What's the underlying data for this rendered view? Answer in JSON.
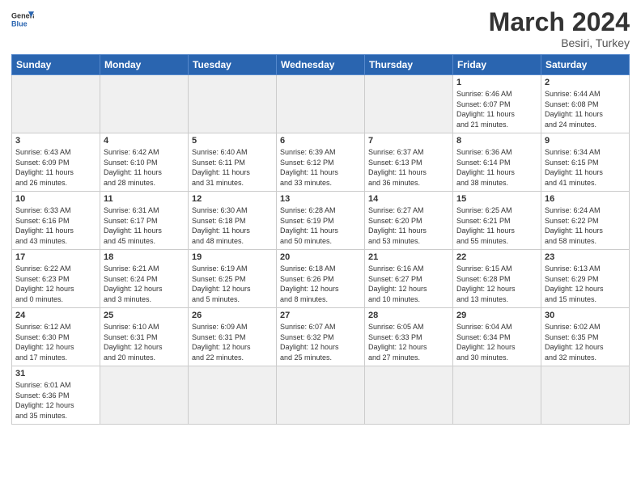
{
  "header": {
    "logo_general": "General",
    "logo_blue": "Blue",
    "month_title": "March 2024",
    "location": "Besiri, Turkey"
  },
  "weekdays": [
    "Sunday",
    "Monday",
    "Tuesday",
    "Wednesday",
    "Thursday",
    "Friday",
    "Saturday"
  ],
  "weeks": [
    [
      {
        "day": "",
        "info": ""
      },
      {
        "day": "",
        "info": ""
      },
      {
        "day": "",
        "info": ""
      },
      {
        "day": "",
        "info": ""
      },
      {
        "day": "",
        "info": ""
      },
      {
        "day": "1",
        "info": "Sunrise: 6:46 AM\nSunset: 6:07 PM\nDaylight: 11 hours\nand 21 minutes."
      },
      {
        "day": "2",
        "info": "Sunrise: 6:44 AM\nSunset: 6:08 PM\nDaylight: 11 hours\nand 24 minutes."
      }
    ],
    [
      {
        "day": "3",
        "info": "Sunrise: 6:43 AM\nSunset: 6:09 PM\nDaylight: 11 hours\nand 26 minutes."
      },
      {
        "day": "4",
        "info": "Sunrise: 6:42 AM\nSunset: 6:10 PM\nDaylight: 11 hours\nand 28 minutes."
      },
      {
        "day": "5",
        "info": "Sunrise: 6:40 AM\nSunset: 6:11 PM\nDaylight: 11 hours\nand 31 minutes."
      },
      {
        "day": "6",
        "info": "Sunrise: 6:39 AM\nSunset: 6:12 PM\nDaylight: 11 hours\nand 33 minutes."
      },
      {
        "day": "7",
        "info": "Sunrise: 6:37 AM\nSunset: 6:13 PM\nDaylight: 11 hours\nand 36 minutes."
      },
      {
        "day": "8",
        "info": "Sunrise: 6:36 AM\nSunset: 6:14 PM\nDaylight: 11 hours\nand 38 minutes."
      },
      {
        "day": "9",
        "info": "Sunrise: 6:34 AM\nSunset: 6:15 PM\nDaylight: 11 hours\nand 41 minutes."
      }
    ],
    [
      {
        "day": "10",
        "info": "Sunrise: 6:33 AM\nSunset: 6:16 PM\nDaylight: 11 hours\nand 43 minutes."
      },
      {
        "day": "11",
        "info": "Sunrise: 6:31 AM\nSunset: 6:17 PM\nDaylight: 11 hours\nand 45 minutes."
      },
      {
        "day": "12",
        "info": "Sunrise: 6:30 AM\nSunset: 6:18 PM\nDaylight: 11 hours\nand 48 minutes."
      },
      {
        "day": "13",
        "info": "Sunrise: 6:28 AM\nSunset: 6:19 PM\nDaylight: 11 hours\nand 50 minutes."
      },
      {
        "day": "14",
        "info": "Sunrise: 6:27 AM\nSunset: 6:20 PM\nDaylight: 11 hours\nand 53 minutes."
      },
      {
        "day": "15",
        "info": "Sunrise: 6:25 AM\nSunset: 6:21 PM\nDaylight: 11 hours\nand 55 minutes."
      },
      {
        "day": "16",
        "info": "Sunrise: 6:24 AM\nSunset: 6:22 PM\nDaylight: 11 hours\nand 58 minutes."
      }
    ],
    [
      {
        "day": "17",
        "info": "Sunrise: 6:22 AM\nSunset: 6:23 PM\nDaylight: 12 hours\nand 0 minutes."
      },
      {
        "day": "18",
        "info": "Sunrise: 6:21 AM\nSunset: 6:24 PM\nDaylight: 12 hours\nand 3 minutes."
      },
      {
        "day": "19",
        "info": "Sunrise: 6:19 AM\nSunset: 6:25 PM\nDaylight: 12 hours\nand 5 minutes."
      },
      {
        "day": "20",
        "info": "Sunrise: 6:18 AM\nSunset: 6:26 PM\nDaylight: 12 hours\nand 8 minutes."
      },
      {
        "day": "21",
        "info": "Sunrise: 6:16 AM\nSunset: 6:27 PM\nDaylight: 12 hours\nand 10 minutes."
      },
      {
        "day": "22",
        "info": "Sunrise: 6:15 AM\nSunset: 6:28 PM\nDaylight: 12 hours\nand 13 minutes."
      },
      {
        "day": "23",
        "info": "Sunrise: 6:13 AM\nSunset: 6:29 PM\nDaylight: 12 hours\nand 15 minutes."
      }
    ],
    [
      {
        "day": "24",
        "info": "Sunrise: 6:12 AM\nSunset: 6:30 PM\nDaylight: 12 hours\nand 17 minutes."
      },
      {
        "day": "25",
        "info": "Sunrise: 6:10 AM\nSunset: 6:31 PM\nDaylight: 12 hours\nand 20 minutes."
      },
      {
        "day": "26",
        "info": "Sunrise: 6:09 AM\nSunset: 6:31 PM\nDaylight: 12 hours\nand 22 minutes."
      },
      {
        "day": "27",
        "info": "Sunrise: 6:07 AM\nSunset: 6:32 PM\nDaylight: 12 hours\nand 25 minutes."
      },
      {
        "day": "28",
        "info": "Sunrise: 6:05 AM\nSunset: 6:33 PM\nDaylight: 12 hours\nand 27 minutes."
      },
      {
        "day": "29",
        "info": "Sunrise: 6:04 AM\nSunset: 6:34 PM\nDaylight: 12 hours\nand 30 minutes."
      },
      {
        "day": "30",
        "info": "Sunrise: 6:02 AM\nSunset: 6:35 PM\nDaylight: 12 hours\nand 32 minutes."
      }
    ],
    [
      {
        "day": "31",
        "info": "Sunrise: 6:01 AM\nSunset: 6:36 PM\nDaylight: 12 hours\nand 35 minutes."
      },
      {
        "day": "",
        "info": ""
      },
      {
        "day": "",
        "info": ""
      },
      {
        "day": "",
        "info": ""
      },
      {
        "day": "",
        "info": ""
      },
      {
        "day": "",
        "info": ""
      },
      {
        "day": "",
        "info": ""
      }
    ]
  ]
}
